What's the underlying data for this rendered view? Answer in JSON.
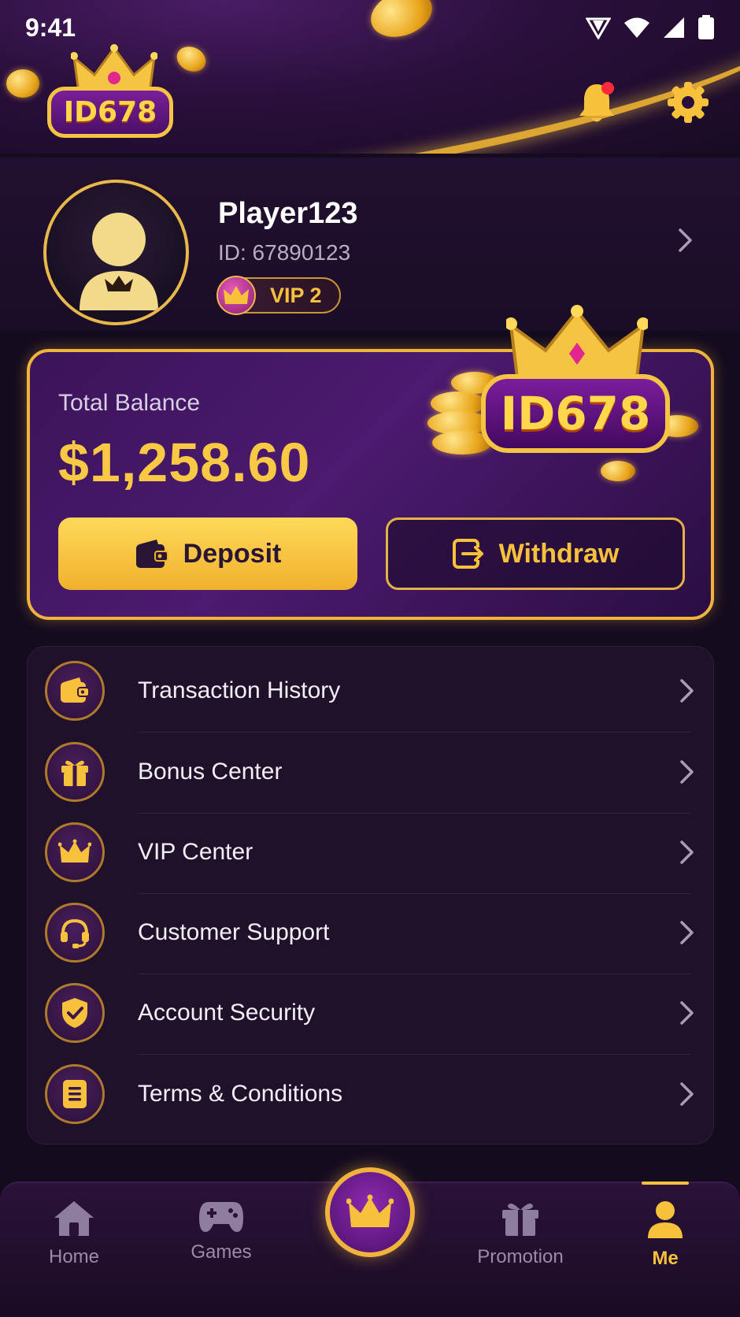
{
  "status_bar": {
    "time": "9:41"
  },
  "brand": {
    "logo_text": "ID678"
  },
  "profile": {
    "name": "Player123",
    "id_text": "ID: 67890123",
    "vip_label": "VIP 2"
  },
  "balance": {
    "label": "Total Balance",
    "amount": "$1,258.60",
    "deposit_label": "Deposit",
    "withdraw_label": "Withdraw"
  },
  "menu": [
    {
      "label": "Transaction History",
      "icon": "wallet-icon"
    },
    {
      "label": "Bonus Center",
      "icon": "gift-icon"
    },
    {
      "label": "VIP Center",
      "icon": "crown-icon"
    },
    {
      "label": "Customer Support",
      "icon": "headset-icon"
    },
    {
      "label": "Account Security",
      "icon": "shield-icon"
    },
    {
      "label": "Terms & Conditions",
      "icon": "document-icon"
    }
  ],
  "nav": {
    "home": "Home",
    "games": "Games",
    "promotion": "Promotion",
    "me": "Me",
    "active": "me"
  },
  "colors": {
    "accent_gold": "#f7c13c",
    "background": "#140b1f",
    "card_purple": "#4c1a70",
    "notification_red": "#ff2a3a"
  }
}
